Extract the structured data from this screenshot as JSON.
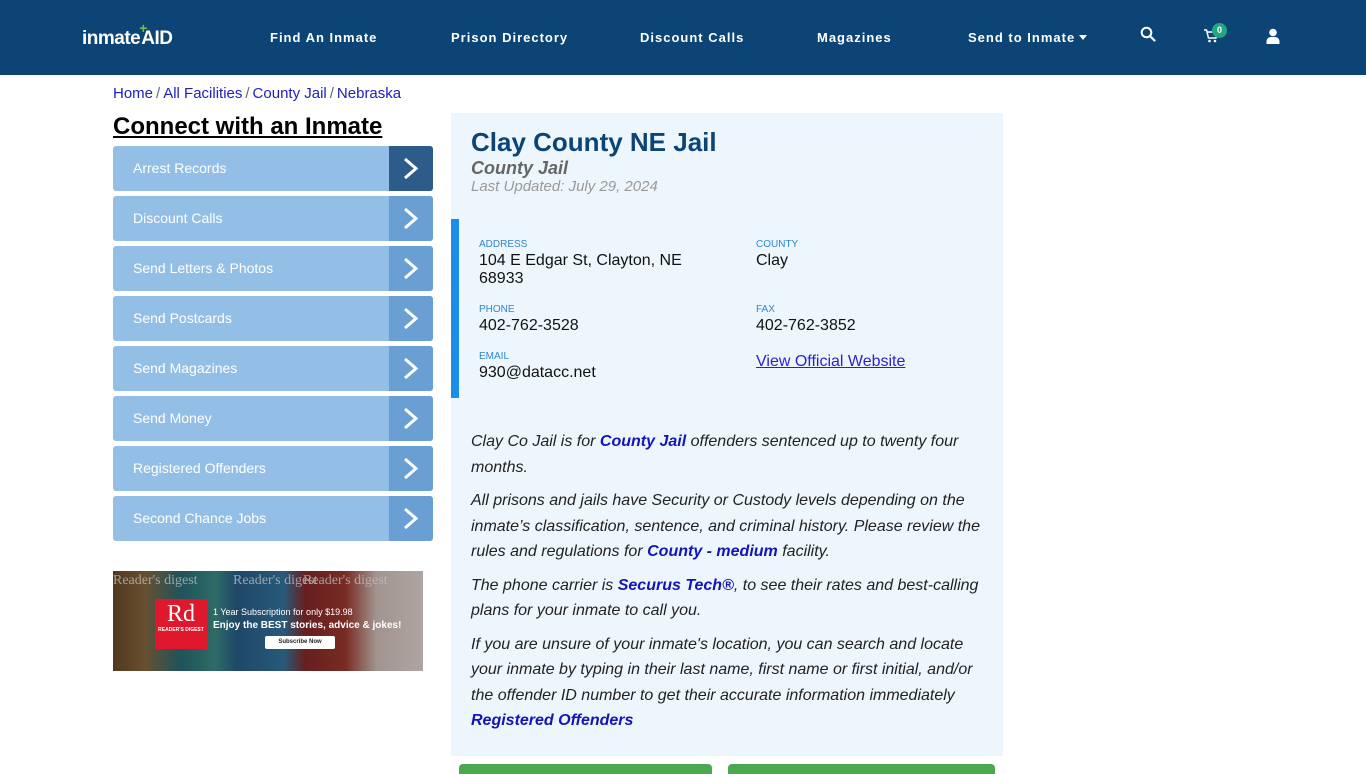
{
  "header": {
    "logo_text": "inmate",
    "logo_accent": "AID",
    "nav": [
      {
        "label": "Find An Inmate"
      },
      {
        "label": "Prison Directory"
      },
      {
        "label": "Discount Calls"
      },
      {
        "label": "Magazines"
      },
      {
        "label": "Send to Inmate",
        "has_dropdown": true
      }
    ],
    "icons": [
      "search-icon",
      "cart-icon",
      "user-icon"
    ],
    "cart_count": "0"
  },
  "breadcrumb": [
    {
      "label": "Home"
    },
    {
      "label": "All Facilities"
    },
    {
      "label": "County Jail"
    },
    {
      "label": "Nebraska"
    }
  ],
  "breadcrumb_separator": "/",
  "sidebar": {
    "title": "Connect with an Inmate",
    "items": [
      {
        "label": "Arrest Records"
      },
      {
        "label": "Discount Calls"
      },
      {
        "label": "Send Letters & Photos"
      },
      {
        "label": "Send Postcards"
      },
      {
        "label": "Send Magazines"
      },
      {
        "label": "Send Money"
      },
      {
        "label": "Registered Offenders"
      },
      {
        "label": "Second Chance Jobs"
      }
    ]
  },
  "ad": {
    "brand_short": "Rd",
    "brand_name": "READER'S DIGEST",
    "masthead": "Reader's digest",
    "line1": "1 Year Subscription for only $19.98",
    "line2": "Enjoy the BEST stories, advice & jokes!",
    "cta": "Subscribe Now"
  },
  "facility": {
    "name": "Clay County NE Jail",
    "type": "County Jail",
    "last_updated": "Last Updated: July 29, 2024",
    "address_label": "ADDRESS",
    "address": "104 E Edgar St, Clayton, NE 68933",
    "county_label": "COUNTY",
    "county": "Clay",
    "phone_label": "PHONE",
    "phone": "402-762-3528",
    "fax_label": "FAX",
    "fax": "402-762-3852",
    "email_label": "EMAIL",
    "email": "930@datacc.net",
    "website_link": "View Official Website"
  },
  "description": {
    "p1_a": "Clay Co Jail is for ",
    "p1_link": "County Jail",
    "p1_b": " offenders sentenced up to twenty four months.",
    "p2_a": "All prisons and jails have Security or Custody levels depending on the inmate’s classification, sentence, and criminal history. Please review the rules and regulations for ",
    "p2_link": "County - medium",
    "p2_b": " facility.",
    "p3_a": "The phone carrier is ",
    "p3_link": "Securus Tech®",
    "p3_b": ", to see their rates and best-calling plans for your inmate to call you.",
    "p4_a": "If you are unsure of your inmate's location, you can search and locate your inmate by typing in their last name, first name or first initial, and/or the offender ID number to get their accurate information immediately",
    "p4_link": "Registered Offenders"
  },
  "colors": {
    "header_bg": "#0c4476",
    "menu_item": "#93bfe7",
    "menu_arrow": "#6a9fd4",
    "menu_arrow_active": "#2e5c8a",
    "panel_bg": "#edf6fd",
    "accent_border": "#1a8ee8",
    "cart_badge": "#22a783",
    "button_green": "#4aa84e"
  }
}
